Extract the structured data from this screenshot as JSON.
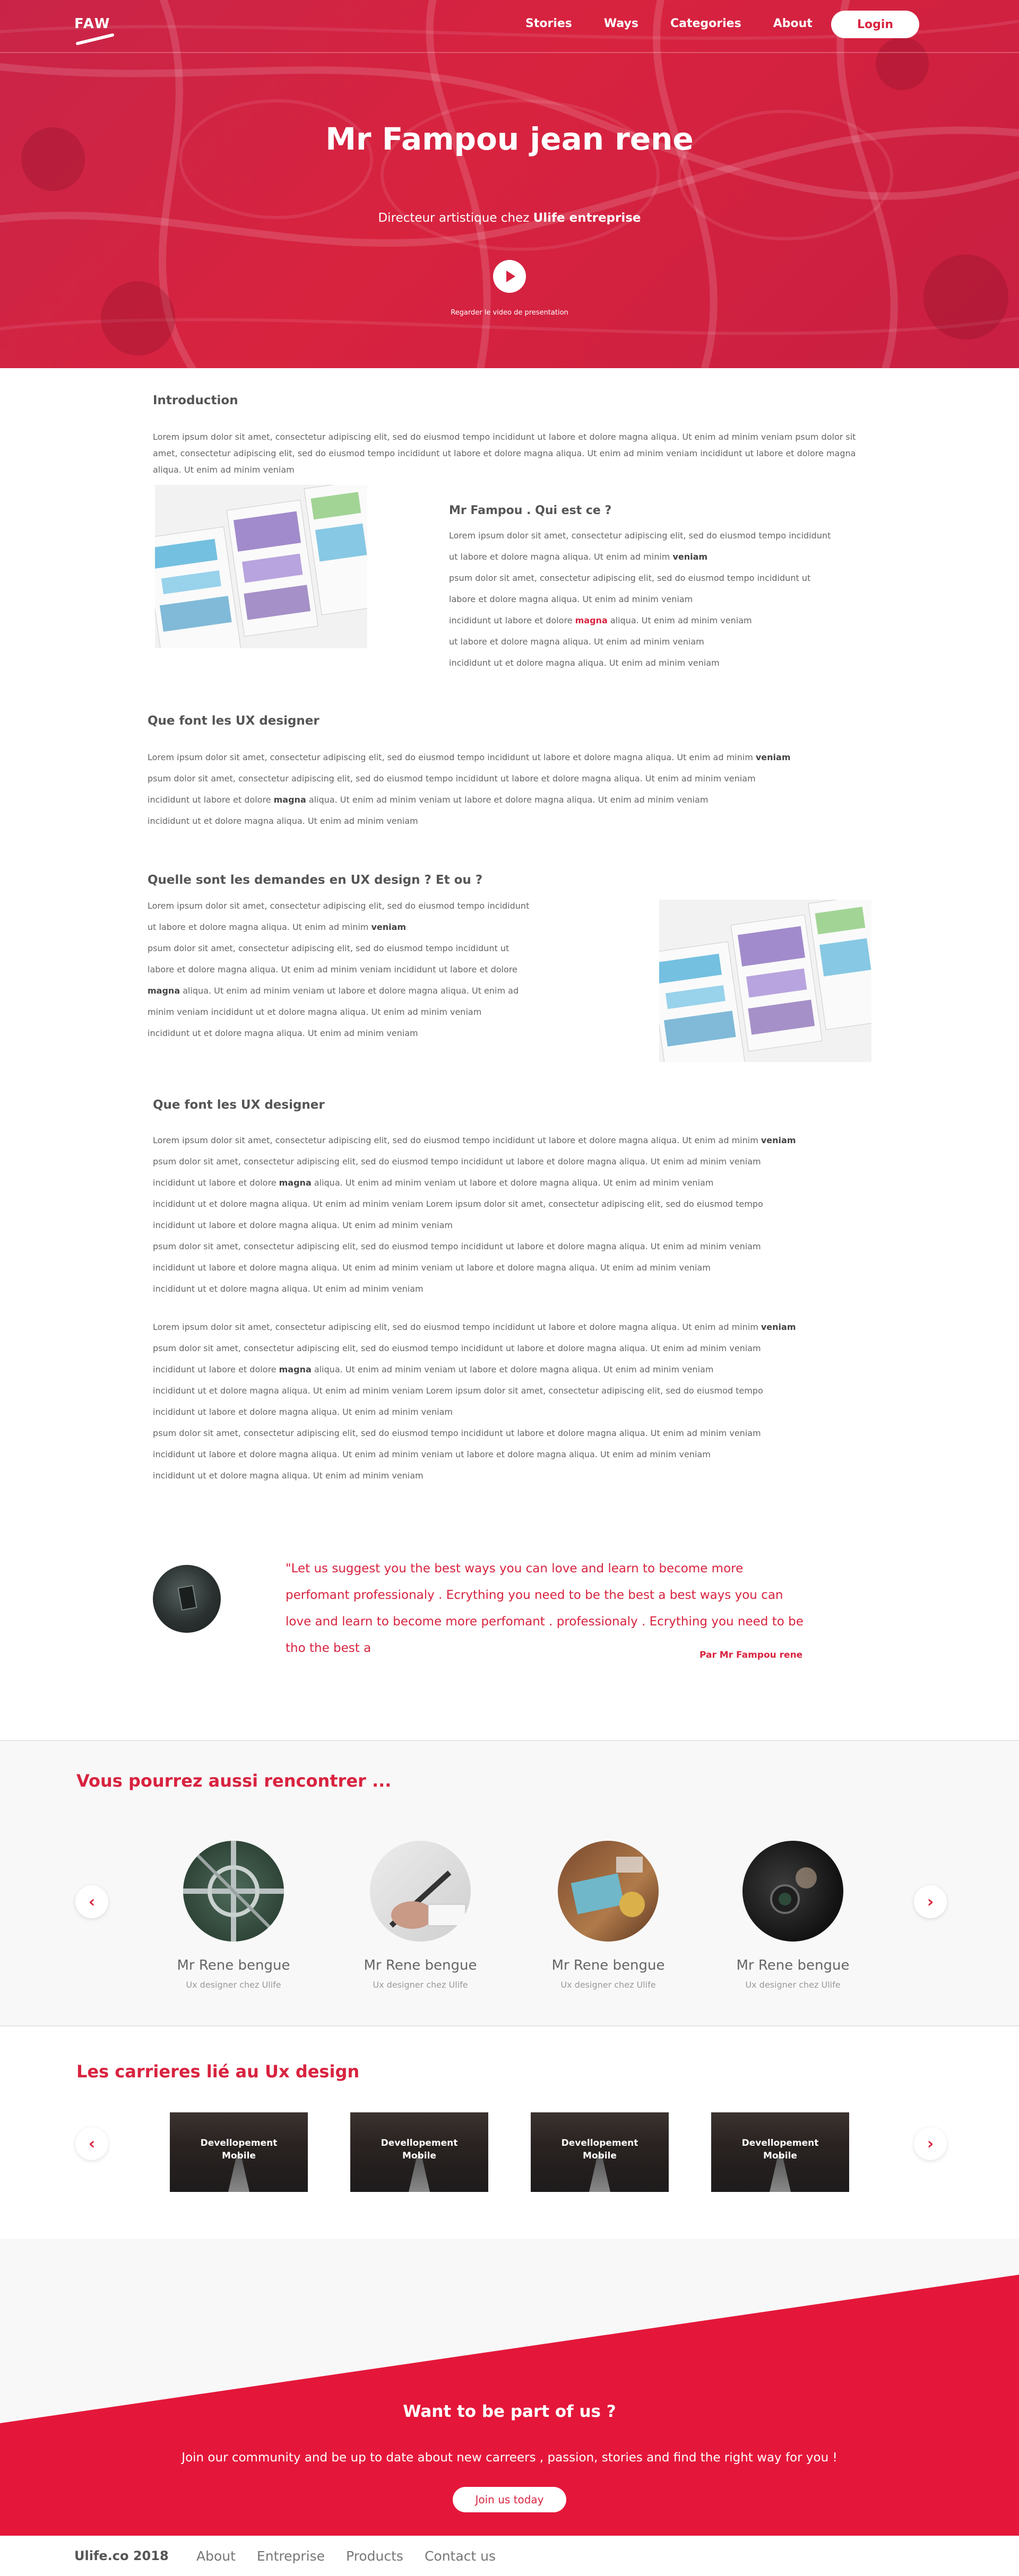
{
  "header": {
    "logo_text": "FAW",
    "nav": [
      "Stories",
      "Ways",
      "Categories",
      "About"
    ],
    "login_label": "Login"
  },
  "hero": {
    "title": "Mr Fampou jean rene",
    "subtitle_prefix": "Directeur artistique chez ",
    "subtitle_company": "Ulife entreprise",
    "video_caption": "Regarder le video de presentation"
  },
  "intro": {
    "heading": "Introduction",
    "text": "Lorem ipsum dolor sit amet, consectetur adipiscing elit, sed do eiusmod tempo incididunt ut labore et dolore magna aliqua. Ut enim ad minim veniam psum dolor sit amet, consectetur adipiscing elit, sed do eiusmod tempo incididunt ut labore et dolore magna aliqua. Ut enim ad minim veniam incididunt ut labore et dolore magna aliqua. Ut enim ad minim veniam"
  },
  "who": {
    "heading": "Mr Fampou . Qui est ce ?",
    "lines": [
      "Lorem ipsum dolor sit amet, consectetur adipiscing elit, sed do eiusmod tempo incididunt",
      "ut labore et dolore magna aliqua. Ut enim ad minim ",
      "psum dolor sit amet, consectetur adipiscing elit, sed do eiusmod tempo incididunt ut",
      "labore et dolore magna aliqua. Ut enim ad minim veniam",
      "incididunt ut labore et dolore ",
      "ut labore et dolore magna aliqua. Ut enim ad minim veniam",
      "incididunt ut et dolore magna aliqua. Ut enim ad minim veniam"
    ],
    "bold_word": "veniam",
    "highlight_word": "magna",
    "highlight_tail": " aliqua. Ut enim ad minim veniam"
  },
  "ux1": {
    "heading": "Que font les UX designer",
    "lines": [
      "Lorem ipsum dolor sit amet, consectetur adipiscing elit, sed do eiusmod tempo incididunt ut labore et dolore magna aliqua. Ut enim ad minim ",
      "psum dolor sit amet, consectetur adipiscing elit, sed do eiusmod tempo incididunt ut labore et dolore magna aliqua. Ut enim ad minim veniam",
      "incididunt ut labore et dolore ",
      "incididunt ut et dolore magna aliqua. Ut enim ad minim veniam"
    ],
    "bold_end": "veniam",
    "bold_mid": "magna",
    "line3_tail": " aliqua. Ut enim ad minim veniam ut labore et dolore magna aliqua. Ut enim ad minim veniam"
  },
  "demand": {
    "heading": "Quelle sont les demandes en UX design ? Et ou ?",
    "lines": [
      "Lorem ipsum dolor sit amet, consectetur adipiscing elit, sed do eiusmod tempo incididunt",
      "ut labore et dolore magna aliqua. Ut enim ad minim ",
      "psum dolor sit amet, consectetur adipiscing elit, sed do eiusmod tempo incididunt ut",
      "labore et dolore magna aliqua. Ut enim ad minim veniam incididunt ut labore et dolore",
      " aliqua. Ut enim ad minim veniam ut labore et dolore magna aliqua. Ut enim ad",
      "minim veniam incididunt ut et dolore magna aliqua. Ut enim ad minim veniam",
      "incididunt ut et dolore magna aliqua. Ut enim ad minim veniam"
    ],
    "bold_word": "veniam",
    "bold_magna": "magna"
  },
  "ux2": {
    "heading": "Que font les UX designer",
    "block_lines": [
      "Lorem ipsum dolor sit amet, consectetur adipiscing elit, sed do eiusmod tempo incididunt ut labore et dolore magna aliqua. Ut enim ad minim ",
      "psum dolor sit amet, consectetur adipiscing elit, sed do eiusmod tempo incididunt ut labore et dolore magna aliqua. Ut enim ad minim veniam",
      "incididunt ut labore et dolore ",
      "incididunt ut et dolore magna aliqua. Ut enim ad minim veniam Lorem ipsum dolor sit amet, consectetur adipiscing elit, sed do eiusmod tempo",
      "incididunt ut labore et dolore magna aliqua. Ut enim ad minim veniam",
      "psum dolor sit amet, consectetur adipiscing elit, sed do eiusmod tempo incididunt ut labore et dolore magna aliqua. Ut enim ad minim veniam",
      "incididunt ut labore et dolore magna aliqua. Ut enim ad minim veniam ut labore et dolore magna aliqua. Ut enim ad minim veniam",
      "incididunt ut et dolore magna aliqua. Ut enim ad minim veniam"
    ],
    "bold_end": "veniam",
    "bold_mid": "magna",
    "line3_tail": " aliqua. Ut enim ad minim veniam ut labore et dolore magna aliqua. Ut enim ad minim veniam"
  },
  "quote": {
    "text": "\"Let us suggest you the best ways you can love and learn to become more perfomant professionaly . Ecrything you need to be the best a  best ways you can love and learn to become more perfomant . professionaly . Ecrything you need to be tho the best a",
    "author": "Par Mr Fampou rene"
  },
  "meet": {
    "title": "Vous pourrez aussi rencontrer ...",
    "people": [
      {
        "name": "Mr Rene bengue",
        "role": "Ux designer chez Ulife"
      },
      {
        "name": "Mr Rene bengue",
        "role": "Ux designer chez Ulife"
      },
      {
        "name": "Mr Rene bengue",
        "role": "Ux designer chez Ulife"
      },
      {
        "name": "Mr Rene bengue",
        "role": "Ux designer chez Ulife"
      }
    ],
    "prev_icon": "chevron-left-icon",
    "next_icon": "chevron-right-icon"
  },
  "careers": {
    "title": "Les carrieres lié au Ux design",
    "items": [
      {
        "line1": "Devellopement",
        "line2": "Mobile"
      },
      {
        "line1": "Devellopement",
        "line2": "Mobile"
      },
      {
        "line1": "Devellopement",
        "line2": "Mobile"
      },
      {
        "line1": "Devellopement",
        "line2": "Mobile"
      }
    ]
  },
  "join": {
    "title": "Want to be part of us ?",
    "text": "Join our community and be up to date about new carreers , passion, stories and find the right way for you !",
    "button": "Join us today"
  },
  "footer": {
    "brand": "Ulife.co 2018",
    "links": [
      "About",
      "Entreprise",
      "Products",
      "Contact us"
    ]
  },
  "colors": {
    "accent": "#d8233f",
    "text": "#555555",
    "muted": "#999999",
    "panel": "#f8f8f8"
  }
}
